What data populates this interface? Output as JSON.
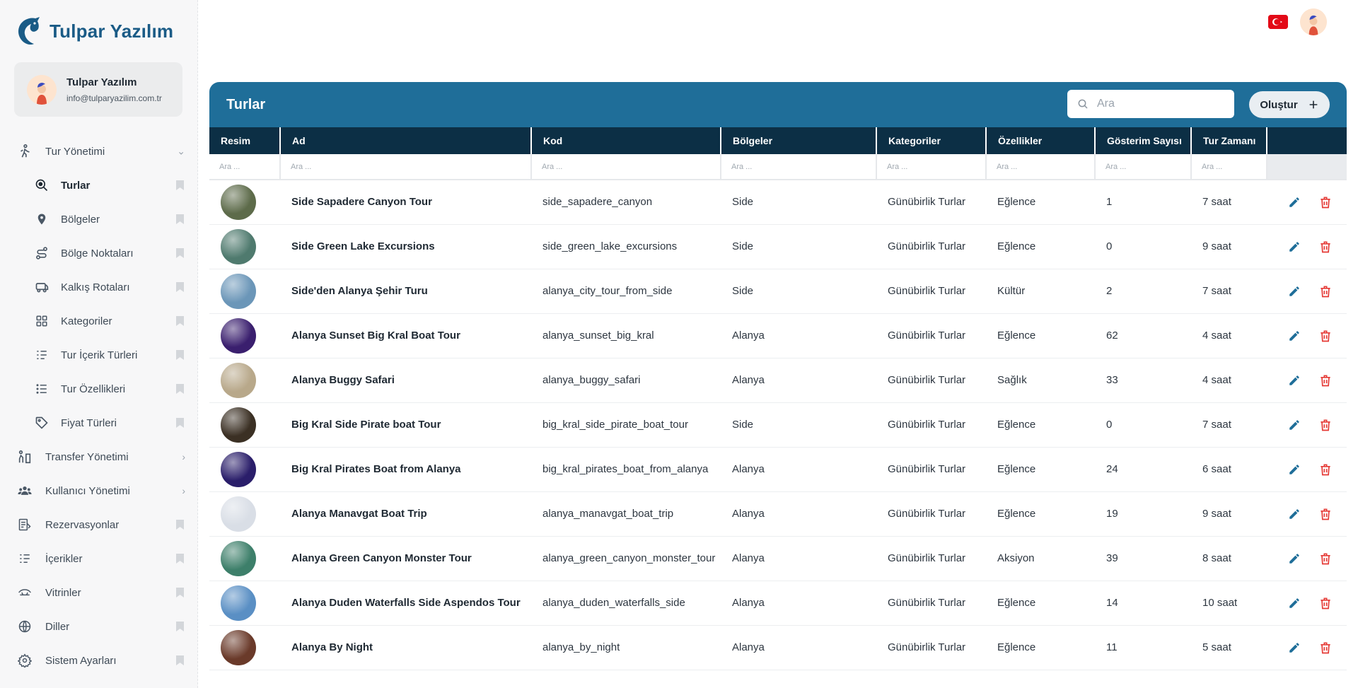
{
  "brand": {
    "name": "Tulpar Yazılım"
  },
  "user": {
    "name": "Tulpar Yazılım",
    "email": "info@tulparyazilim.com.tr"
  },
  "sidebar": {
    "items": [
      {
        "label": "Tur Yönetimi",
        "icon": "hiking-icon",
        "expanded": true
      },
      {
        "label": "Turlar",
        "icon": "search-map-icon",
        "sub": true,
        "active": true
      },
      {
        "label": "Bölgeler",
        "icon": "map-pin-icon",
        "sub": true
      },
      {
        "label": "Bölge Noktaları",
        "icon": "route-icon",
        "sub": true
      },
      {
        "label": "Kalkış Rotaları",
        "icon": "bus-icon",
        "sub": true
      },
      {
        "label": "Kategoriler",
        "icon": "grid-icon",
        "sub": true
      },
      {
        "label": "Tur İçerik Türleri",
        "icon": "list-check-icon",
        "sub": true
      },
      {
        "label": "Tur Özellikleri",
        "icon": "list-icon",
        "sub": true
      },
      {
        "label": "Fiyat Türleri",
        "icon": "tag-icon",
        "sub": true
      },
      {
        "label": "Transfer Yönetimi",
        "icon": "transfer-icon",
        "chevron": "›"
      },
      {
        "label": "Kullanıcı Yönetimi",
        "icon": "users-icon",
        "chevron": "›"
      },
      {
        "label": "Rezervasyonlar",
        "icon": "reservation-icon"
      },
      {
        "label": "İçerikler",
        "icon": "content-list-icon"
      },
      {
        "label": "Vitrinler",
        "icon": "showcase-icon"
      },
      {
        "label": "Diller",
        "icon": "globe-icon"
      },
      {
        "label": "Sistem Ayarları",
        "icon": "gear-icon"
      }
    ]
  },
  "header": {
    "flag": "tr-flag-icon"
  },
  "panel": {
    "title": "Turlar",
    "search_placeholder": "Ara",
    "create_label": "Oluştur"
  },
  "table": {
    "columns": [
      "Resim",
      "Ad",
      "Kod",
      "Bölgeler",
      "Kategoriler",
      "Özellikler",
      "Gösterim Sayısı",
      "Tur Zamanı",
      ""
    ],
    "filter_placeholder": "Ara ...",
    "rows": [
      {
        "name": "Side Sapadere Canyon Tour",
        "code": "side_sapadere_canyon",
        "region": "Side",
        "category": "Günübirlik Turlar",
        "feature": "Eğlence",
        "views": "1",
        "duration": "7 saat",
        "thumb": "#5d6b4a"
      },
      {
        "name": "Side Green Lake Excursions",
        "code": "side_green_lake_excursions",
        "region": "Side",
        "category": "Günübirlik Turlar",
        "feature": "Eğlence",
        "views": "0",
        "duration": "9 saat",
        "thumb": "#4f7a6e"
      },
      {
        "name": "Side'den Alanya Şehir Turu",
        "code": "alanya_city_tour_from_side",
        "region": "Side",
        "category": "Günübirlik Turlar",
        "feature": "Kültür",
        "views": "2",
        "duration": "7 saat",
        "thumb": "#6b96b8"
      },
      {
        "name": "Alanya Sunset Big Kral Boat Tour",
        "code": "alanya_sunset_big_kral",
        "region": "Alanya",
        "category": "Günübirlik Turlar",
        "feature": "Eğlence",
        "views": "62",
        "duration": "4 saat",
        "thumb": "#3a1f6e"
      },
      {
        "name": "Alanya Buggy Safari",
        "code": "alanya_buggy_safari",
        "region": "Alanya",
        "category": "Günübirlik Turlar",
        "feature": "Sağlık",
        "views": "33",
        "duration": "4 saat",
        "thumb": "#b8a88a"
      },
      {
        "name": "Big Kral Side Pirate boat Tour",
        "code": "big_kral_side_pirate_boat_tour",
        "region": "Side",
        "category": "Günübirlik Turlar",
        "feature": "Eğlence",
        "views": "0",
        "duration": "7 saat",
        "thumb": "#3b3024"
      },
      {
        "name": "Big Kral Pirates Boat from Alanya",
        "code": "big_kral_pirates_boat_from_alanya",
        "region": "Alanya",
        "category": "Günübirlik Turlar",
        "feature": "Eğlence",
        "views": "24",
        "duration": "6 saat",
        "thumb": "#2a1e6a"
      },
      {
        "name": "Alanya Manavgat Boat Trip",
        "code": "alanya_manavgat_boat_trip",
        "region": "Alanya",
        "category": "Günübirlik Turlar",
        "feature": "Eğlence",
        "views": "19",
        "duration": "9 saat",
        "thumb": "#d9dee6"
      },
      {
        "name": "Alanya Green Canyon Monster Tour",
        "code": "alanya_green_canyon_monster_tour",
        "region": "Alanya",
        "category": "Günübirlik Turlar",
        "feature": "Aksiyon",
        "views": "39",
        "duration": "8 saat",
        "thumb": "#3d7f6a"
      },
      {
        "name": "Alanya Duden Waterfalls Side Aspendos Tour",
        "code": "alanya_duden_waterfalls_side",
        "region": "Alanya",
        "category": "Günübirlik Turlar",
        "feature": "Eğlence",
        "views": "14",
        "duration": "10 saat",
        "thumb": "#5a8fc4"
      },
      {
        "name": "Alanya By Night",
        "code": "alanya_by_night",
        "region": "Alanya",
        "category": "Günübirlik Turlar",
        "feature": "Eğlence",
        "views": "11",
        "duration": "5 saat",
        "thumb": "#6a3a2a"
      }
    ]
  },
  "colors": {
    "primary": "#1f6e99",
    "header_dark": "#0c2f45",
    "edit": "#1f6e99",
    "delete": "#e53935"
  }
}
